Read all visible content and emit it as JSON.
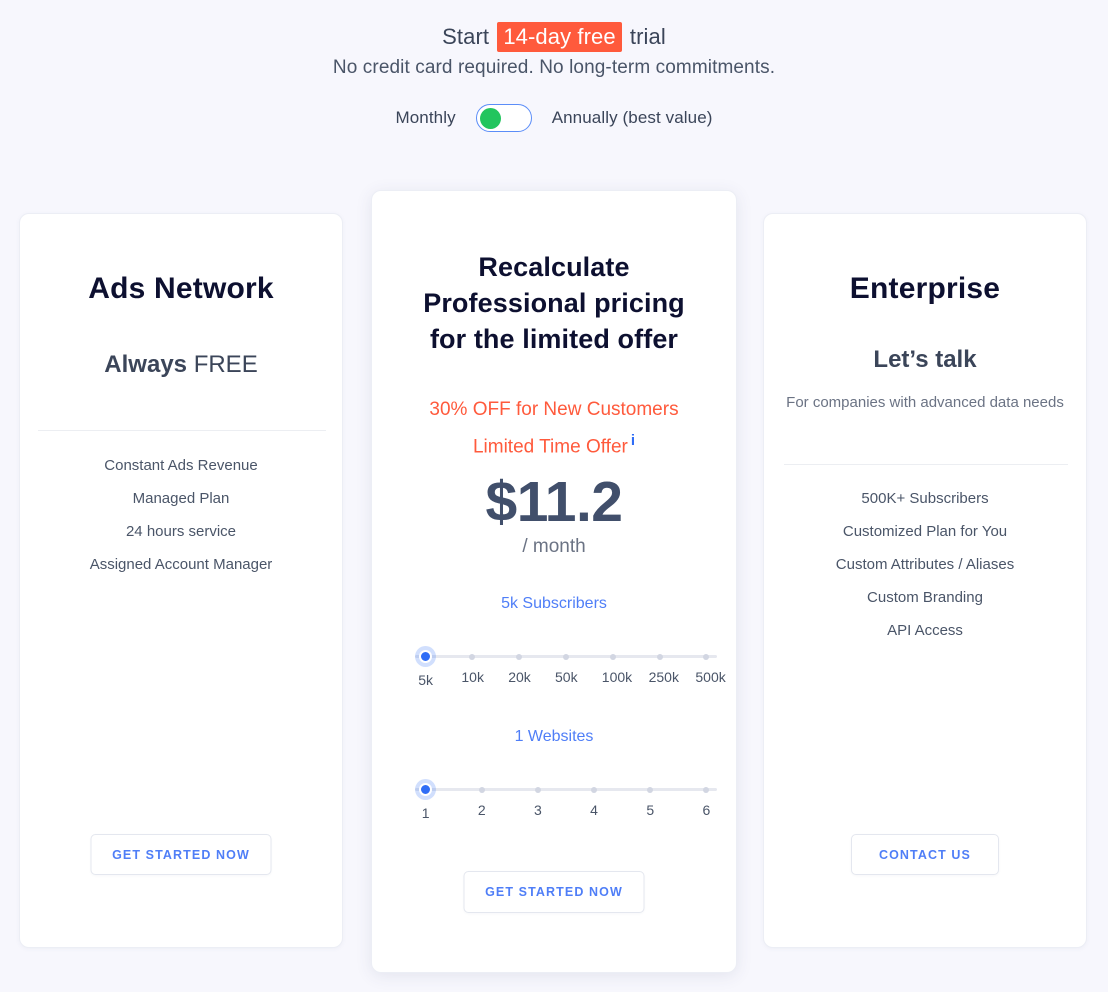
{
  "header": {
    "headline_pre": "Start",
    "headline_mark": "14-day free",
    "headline_post": "trial",
    "subline": "No credit card required. No long-term commitments."
  },
  "billing": {
    "monthly_label": "Monthly",
    "annual_label": "Annually (best value)",
    "selected": "Monthly",
    "knob_color": "#22c55e"
  },
  "plans": {
    "left": {
      "title": "Ads Network",
      "price_strong": "Always",
      "price_rest": "FREE",
      "features": [
        "Constant Ads Revenue",
        "Managed Plan",
        "24 hours service",
        "Assigned Account Manager"
      ],
      "cta": "GET STARTED NOW"
    },
    "center": {
      "title_line1": "Recalculate",
      "title_line2": "Professional pricing",
      "title_line3": "for the limited offer",
      "offer_line1": "30% OFF for New Customers",
      "offer_line2": "Limited Time Offer",
      "info_icon": "info-icon",
      "amount": "$11.2",
      "period": "/ month",
      "subscribers_value": "5k Subscribers",
      "subscriber_ticks": [
        "5k",
        "10k",
        "20k",
        "50k",
        "100k",
        "250k",
        "500k"
      ],
      "subscriber_selected_index": 0,
      "websites_value": "1 Websites",
      "website_ticks": [
        "1",
        "2",
        "3",
        "4",
        "5",
        "6"
      ],
      "website_selected_index": 0,
      "cta": "GET STARTED NOW"
    },
    "right": {
      "title": "Enterprise",
      "price": "Let’s talk",
      "subtitle": "For companies with advanced data needs",
      "features": [
        "500K+ Subscribers",
        "Customized Plan for You",
        "Custom Attributes / Aliases",
        "Custom Branding",
        "API Access"
      ],
      "cta": "CONTACT US"
    }
  },
  "colors": {
    "accent_orange": "#ff5a3c",
    "accent_blue": "#4f7ef7",
    "toggle_green": "#22c55e",
    "page_bg": "#f7f7fd"
  }
}
